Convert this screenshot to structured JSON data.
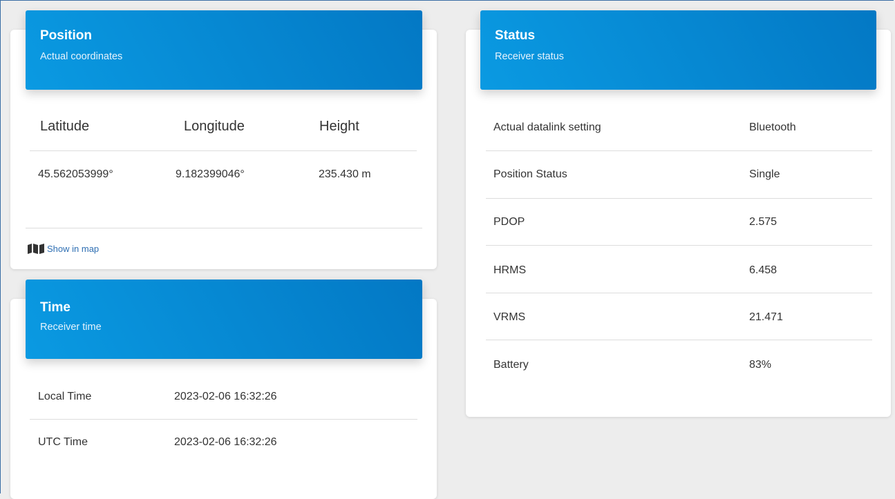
{
  "position": {
    "title": "Position",
    "subtitle": "Actual coordinates",
    "columns": [
      "Latitude",
      "Longitude",
      "Height"
    ],
    "values": [
      "45.562053999°",
      "9.182399046°",
      "235.430 m"
    ],
    "map_link": "Show in map",
    "map_icon": "map-icon"
  },
  "time": {
    "title": "Time",
    "subtitle": "Receiver time",
    "rows": [
      {
        "label": "Local Time",
        "value": "2023-02-06 16:32:26"
      },
      {
        "label": "UTC Time",
        "value": "2023-02-06 16:32:26"
      }
    ]
  },
  "status": {
    "title": "Status",
    "subtitle": "Receiver status",
    "rows": [
      {
        "label": "Actual datalink setting",
        "value": "Bluetooth"
      },
      {
        "label": "Position Status",
        "value": "Single"
      },
      {
        "label": "PDOP",
        "value": "2.575"
      },
      {
        "label": "HRMS",
        "value": "6.458"
      },
      {
        "label": "VRMS",
        "value": "21.471"
      },
      {
        "label": "Battery",
        "value": "83%"
      }
    ]
  },
  "colors": {
    "header_start": "#0a9ae2",
    "header_end": "#0378c4",
    "link": "#2f6fb3",
    "background": "#ededed"
  }
}
